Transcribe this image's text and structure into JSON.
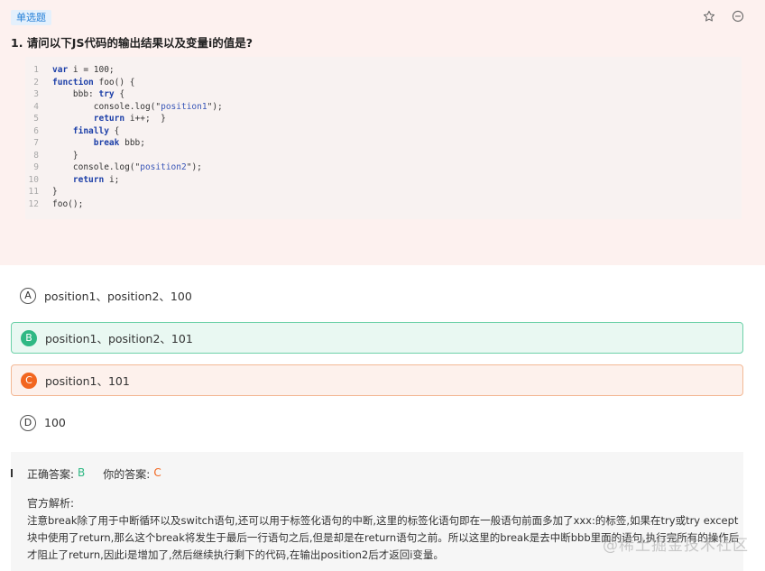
{
  "question": {
    "type_badge": "单选题",
    "title": "1. 请问以下JS代码的输出结果以及变量i的值是?",
    "code_lines": [
      "var i = 100;",
      "function foo() {",
      "    bbb: try {",
      "        console.log(\"position1\");",
      "        return i++;  }",
      "    finally {",
      "        break bbb;",
      "    }",
      "    console.log(\"position2\");",
      "    return i;",
      "}",
      "foo();"
    ],
    "line_numbers": [
      "1",
      "2",
      "3",
      "4",
      "5",
      "6",
      "7",
      "8",
      "9",
      "10",
      "11",
      "12"
    ]
  },
  "header_icons": [
    "star-icon",
    "collapse-icon"
  ],
  "options": [
    {
      "letter": "A",
      "text": "position1、position2、100",
      "state": "normal"
    },
    {
      "letter": "B",
      "text": "position1、position2、101",
      "state": "correct"
    },
    {
      "letter": "C",
      "text": "position1、101",
      "state": "wrong"
    },
    {
      "letter": "D",
      "text": "100",
      "state": "normal"
    }
  ],
  "answer": {
    "correct_label": "正确答案:",
    "correct_value": "B",
    "yours_label": "你的答案:",
    "yours_value": "C",
    "analysis_title": "官方解析:",
    "analysis_text": "注意break除了用于中断循环以及switch语句,还可以用于标签化语句的中断,这里的标签化语句即在一般语句前面多加了xxx:的标签,如果在try或try except块中使用了return,那么这个break将发生于最后一行语句之后,但是却是在return语句之前。所以这里的break是去中断bbb里面的语句,执行完所有的操作后才阻止了return,因此i是增加了,然后继续执行剩下的代码,在输出position2后才返回i变量。"
  },
  "watermark": "@稀土掘金技术社区",
  "colors": {
    "correct": "#2fb884",
    "wrong": "#f2661f",
    "badge": "#2680d8"
  }
}
